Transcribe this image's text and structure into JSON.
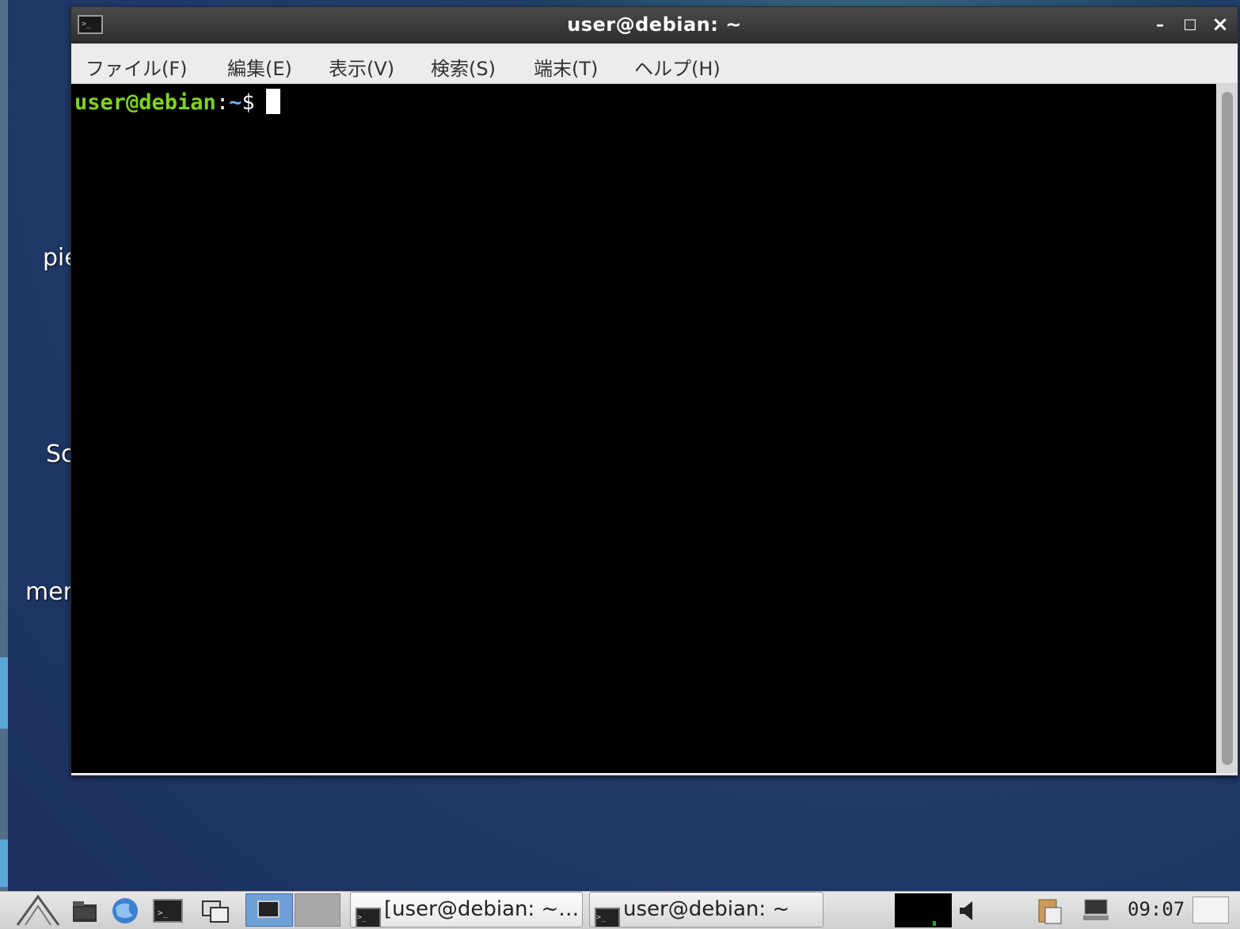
{
  "desktop": {
    "labels": [
      "pie",
      "Sc",
      "mer"
    ]
  },
  "window": {
    "title": "user@debian: ~",
    "controls": {
      "minimize": "–",
      "maximize": "□",
      "close": "×"
    },
    "menu": [
      "ファイル(F)",
      "編集(E)",
      "表示(V)",
      "検索(S)",
      "端末(T)",
      "ヘルプ(H)"
    ],
    "terminal": {
      "prompt_user": "user@debian",
      "prompt_colon": ":",
      "prompt_path": "~",
      "prompt_dollar": "$"
    }
  },
  "taskbar": {
    "tasks": [
      "[user@debian: ~…",
      "user@debian: ~"
    ],
    "clock": "09:07"
  },
  "colors": {
    "prompt_user": "#7ed321",
    "prompt_path": "#6ab0f3",
    "terminal_bg": "#000000"
  }
}
